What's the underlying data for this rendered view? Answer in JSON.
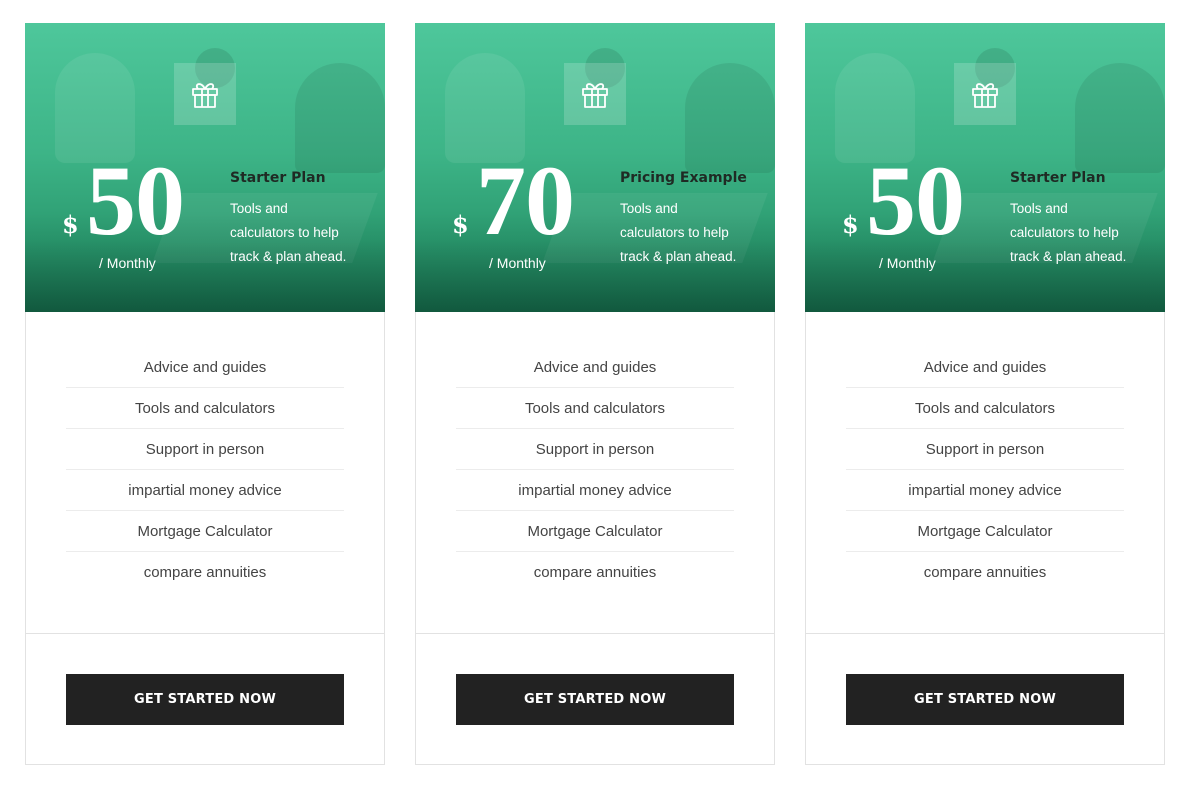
{
  "pricing": {
    "cards": [
      {
        "currency": "$",
        "amount": "50",
        "period": "/ Monthly",
        "name": "Starter Plan",
        "description": "Tools and calculators to help track & plan ahead.",
        "icon": "gift-icon",
        "features": [
          "Advice and guides",
          "Tools and calculators",
          "Support in person",
          "impartial money advice",
          "Mortgage Calculator",
          "compare annuities"
        ],
        "cta": "GET STARTED NOW"
      },
      {
        "currency": "$",
        "amount": "70",
        "period": "/ Monthly",
        "name": "Pricing Example",
        "description": "Tools and calculators to help track & plan ahead.",
        "icon": "gift-icon",
        "features": [
          "Advice and guides",
          "Tools and calculators",
          "Support in person",
          "impartial money advice",
          "Mortgage Calculator",
          "compare annuities"
        ],
        "cta": "GET STARTED NOW"
      },
      {
        "currency": "$",
        "amount": "50",
        "period": "/ Monthly",
        "name": "Starter Plan",
        "description": "Tools and calculators to help track & plan ahead.",
        "icon": "gift-icon",
        "features": [
          "Advice and guides",
          "Tools and calculators",
          "Support in person",
          "impartial money advice",
          "Mortgage Calculator",
          "compare annuities"
        ],
        "cta": "GET STARTED NOW"
      }
    ]
  },
  "colors": {
    "accent_green": "#3db487",
    "button_bg": "#222222",
    "button_text": "#ffffff",
    "feature_text": "#444444"
  }
}
